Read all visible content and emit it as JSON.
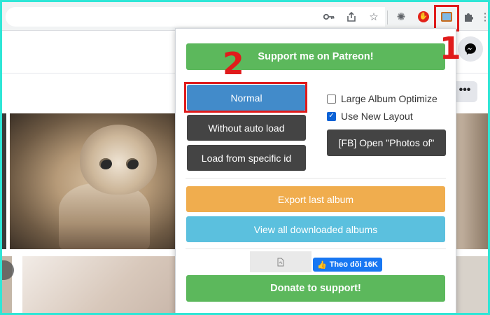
{
  "toolbar": {
    "icons": [
      "key-icon",
      "share-icon",
      "star-icon",
      "extension-gear-icon",
      "adblock-icon",
      "photo-extension-icon",
      "puzzle-icon",
      "more-icon"
    ],
    "adblock_badge": "✋"
  },
  "annotations": {
    "step1": "1",
    "step2": "2"
  },
  "page": {
    "more_button": "•••"
  },
  "popup": {
    "patreon_button": "Support me on Patreon!",
    "normal_button": "Normal",
    "without_auto_load_button": "Without auto load",
    "load_specific_id_button": "Load from specific id",
    "large_album_optimize": {
      "label": "Large Album Optimize",
      "checked": false
    },
    "use_new_layout": {
      "label": "Use New Layout",
      "checked": true
    },
    "fb_open_photos_button": "[FB] Open \"Photos of\"",
    "export_last_album_button": "Export last album",
    "view_downloaded_button": "View all downloaded albums",
    "fb_follow": "Theo dõi 16K",
    "donate_button": "Donate to support!"
  },
  "colors": {
    "green": "#5cb85c",
    "blue": "#428bca",
    "dark": "#444444",
    "orange": "#f0ad4e",
    "cyan": "#5bc0de",
    "highlight_red": "#e01b1b",
    "frame": "#2ee6d6"
  }
}
